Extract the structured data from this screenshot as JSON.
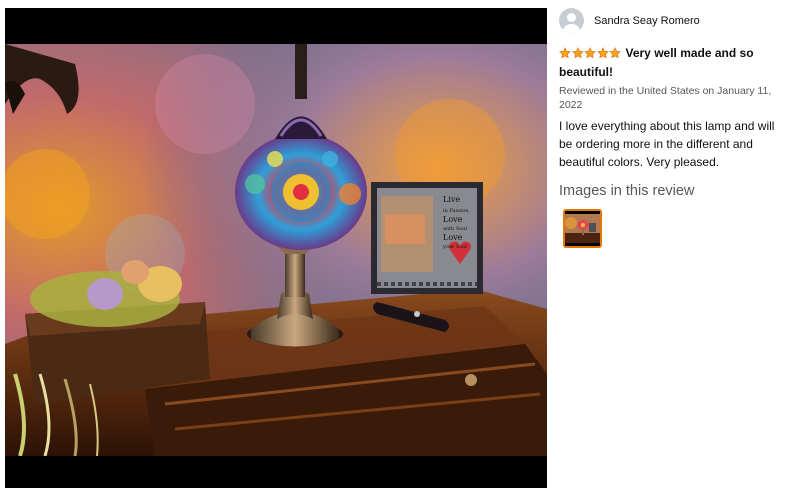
{
  "review": {
    "reviewer_name": "Sandra Seay Romero",
    "rating": 5,
    "rating_max": 5,
    "title": "Very well made and so beautiful!",
    "meta": "Reviewed in the United States on January 11, 2022",
    "body": "I love everything about this lamp and will be ordering more in the different and beautiful colors. Very pleased.",
    "images_heading": "Images in this review"
  },
  "photo": {
    "frame_text_lines": [
      "Live",
      "in Passion",
      "Love",
      "with Soul",
      "Love",
      "your Soul"
    ]
  },
  "colors": {
    "star": "#f7a41d",
    "star_outline": "#de7921",
    "thumb_border": "#e77600",
    "meta_text": "#565959"
  }
}
